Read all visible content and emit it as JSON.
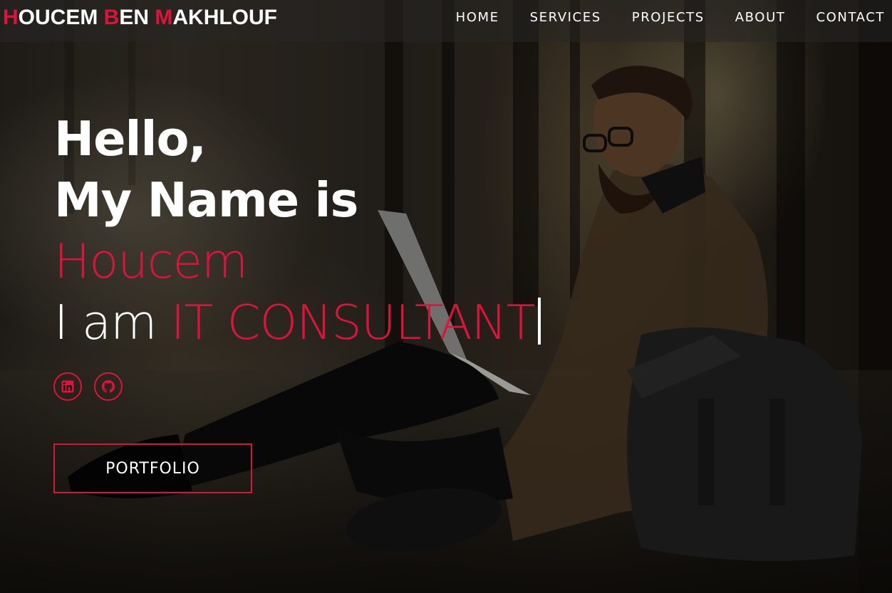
{
  "brand": {
    "parts": [
      {
        "initial": "H",
        "rest": "OUCEM "
      },
      {
        "initial": "B",
        "rest": "EN "
      },
      {
        "initial": "M",
        "rest": "AKHLOUF"
      }
    ]
  },
  "nav": {
    "items": [
      {
        "label": "HOME"
      },
      {
        "label": "SERVICES"
      },
      {
        "label": "PROJECTS"
      },
      {
        "label": "ABOUT"
      },
      {
        "label": "CONTACT"
      }
    ]
  },
  "hero": {
    "greeting": "Hello,",
    "name_intro": "My Name is",
    "name": "Houcem",
    "role_prefix": "I am ",
    "role": "IT CONSULTANT"
  },
  "social": {
    "items": [
      {
        "icon": "linkedin-icon"
      },
      {
        "icon": "github-icon"
      }
    ]
  },
  "cta": {
    "portfolio_label": "PORTFOLIO"
  },
  "colors": {
    "accent": "#dc143c",
    "text": "#ffffff",
    "navbar": "rgba(40,38,36,0.55)"
  }
}
